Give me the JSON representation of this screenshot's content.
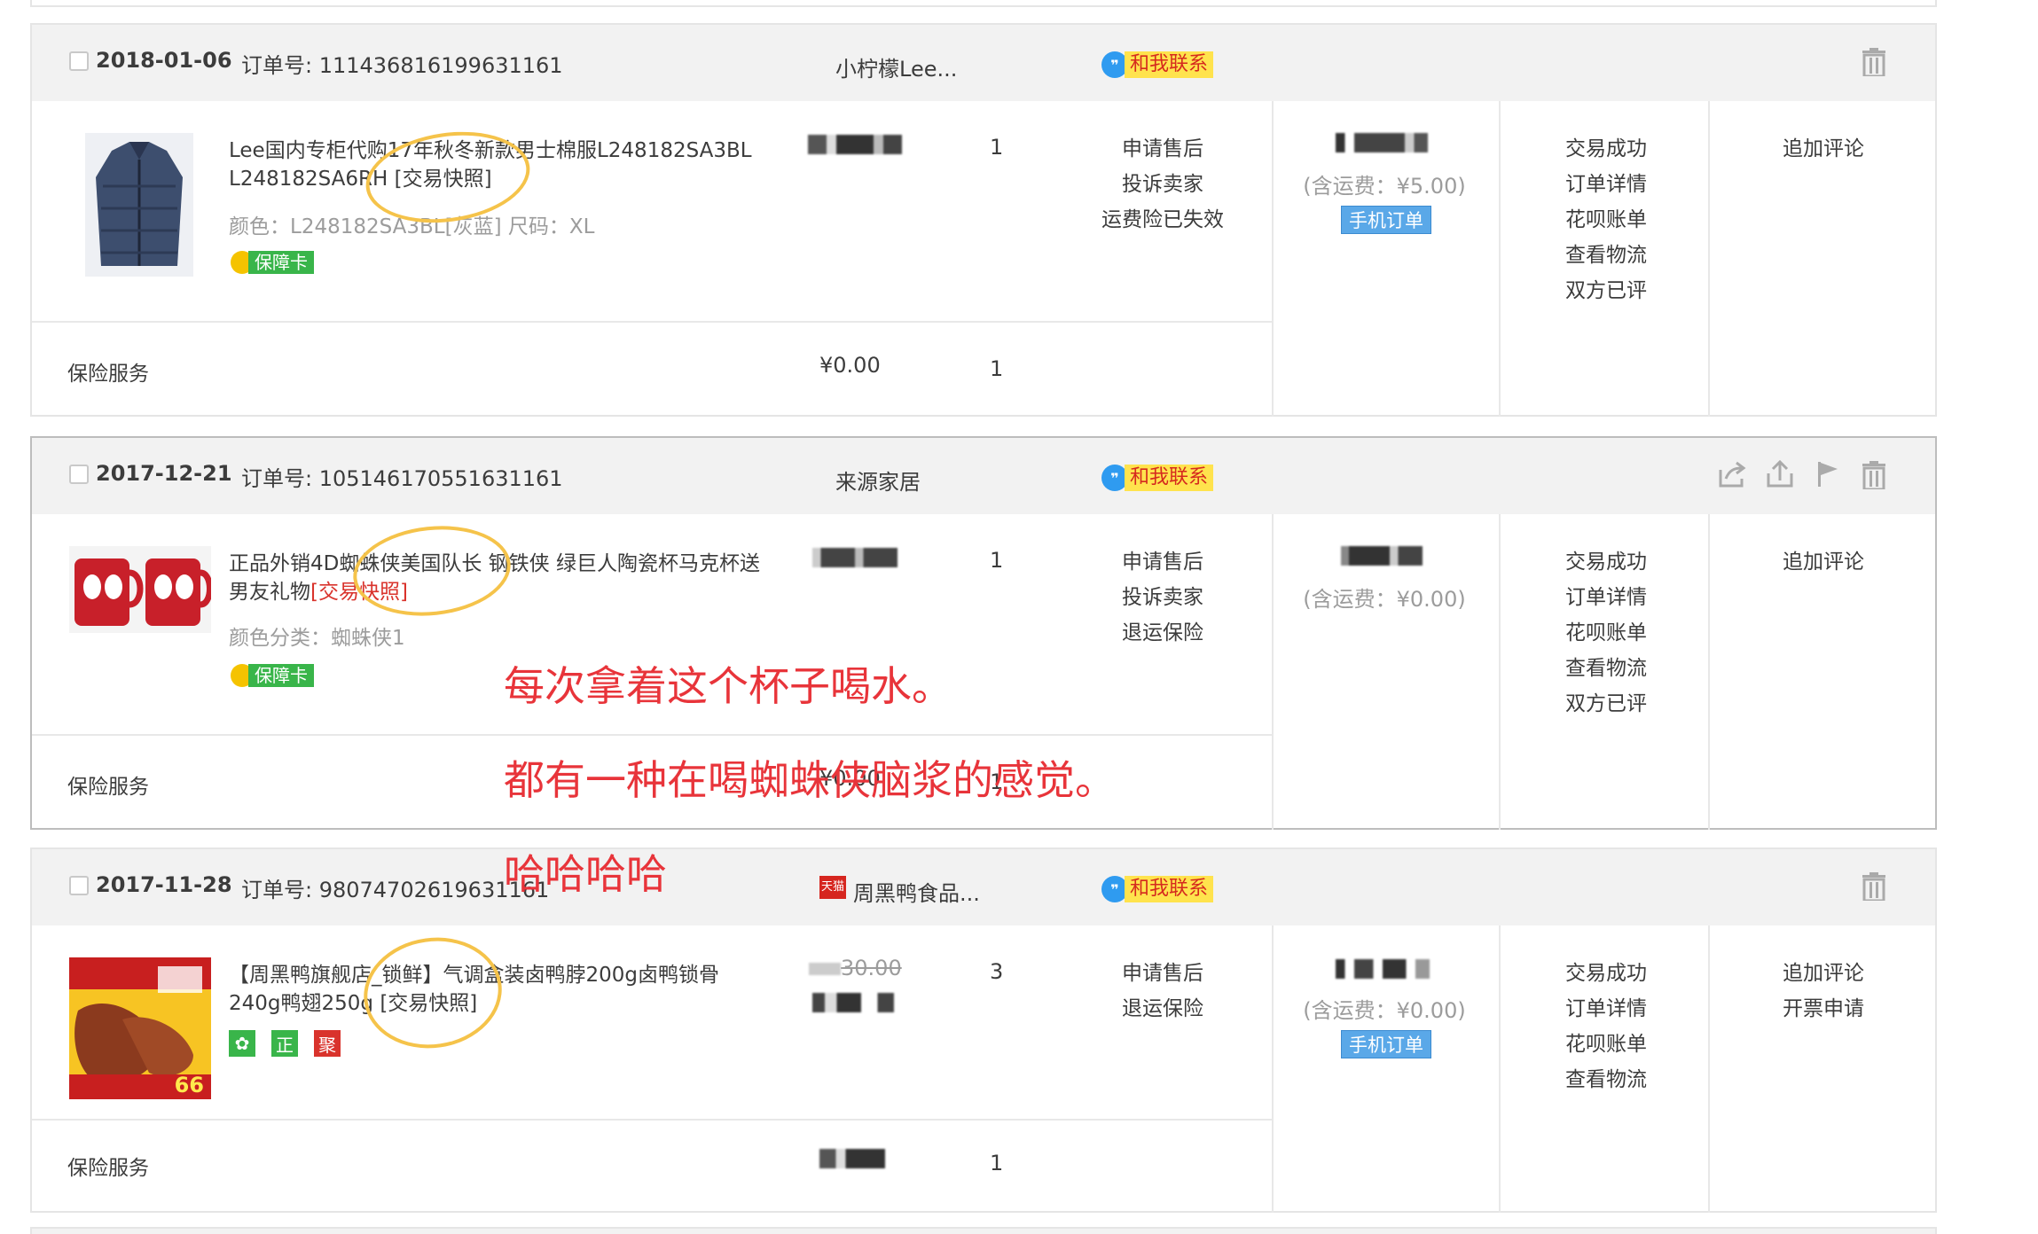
{
  "orders": [
    {
      "date": "2018-01-06",
      "order_no": "订单号: 111436816199631161",
      "shop": "小柠檬Lee...",
      "contact": "和我联系",
      "item_title": "Lee国内专柜代购17年秋冬新款男士棉服L248182SA3BL L248182SA6RH",
      "snapshot": "[交易快照]",
      "item_spec": "颜色：L248182SA3BL[灰蓝] 尺码：XL",
      "guarantee": "保障卡",
      "qty": "1",
      "after_sale": [
        "申请售后",
        "投诉卖家",
        "运费险已失效"
      ],
      "shipping": "(含运费：¥5.00)",
      "mobile_tag": "手机订单",
      "status_links": [
        "交易成功",
        "订单详情",
        "花呗账单",
        "查看物流",
        "双方已评"
      ],
      "action_links": [
        "追加评论"
      ],
      "insurance_label": "保险服务",
      "insurance_price": "¥0.00",
      "insurance_qty": "1"
    },
    {
      "date": "2017-12-21",
      "order_no": "订单号: 105146170551631161",
      "shop": "来源家居",
      "contact": "和我联系",
      "item_title": "正品外销4D蜘蛛侠美国队长 钢铁侠 绿巨人陶瓷杯马克杯送男友礼物",
      "snapshot": "[交易快照]",
      "item_spec": "颜色分类：蜘蛛侠1",
      "guarantee": "保障卡",
      "qty": "1",
      "after_sale": [
        "申请售后",
        "投诉卖家",
        "退运保险"
      ],
      "shipping": "(含运费：¥0.00)",
      "status_links": [
        "交易成功",
        "订单详情",
        "花呗账单",
        "查看物流",
        "双方已评"
      ],
      "action_links": [
        "追加评论"
      ],
      "insurance_label": "保险服务",
      "insurance_price": "¥0.00",
      "insurance_qty": "1"
    },
    {
      "date": "2017-11-28",
      "order_no": "订单号: 98074702619631161",
      "shop_badge": "天猫",
      "shop": "周黑鸭食品...",
      "contact": "和我联系",
      "item_title": "【周黑鸭旗舰店_锁鲜】气调盒装卤鸭脖200g卤鸭锁骨240g鸭翅250g",
      "snapshot": "[交易快照]",
      "service_icons": [
        "正",
        "聚"
      ],
      "price_original": "30.00",
      "qty": "3",
      "after_sale": [
        "申请售后",
        "退运保险"
      ],
      "shipping": "(含运费：¥0.00)",
      "mobile_tag": "手机订单",
      "status_links": [
        "交易成功",
        "订单详情",
        "花呗账单",
        "查看物流"
      ],
      "action_links": [
        "追加评论",
        "开票申请"
      ],
      "insurance_label": "保险服务",
      "insurance_qty": "1",
      "thumb_price": "66"
    }
  ],
  "annotations": [
    "每次拿着这个杯子喝水。",
    "都有一种在喝蜘蛛侠脑浆的感觉。",
    "哈哈哈哈"
  ],
  "colors": {
    "header_bg": "#f2f2f2",
    "contact_yellow": "#ffe34d",
    "annotation_red": "#e8343a",
    "mobile_blue": "#5aa8e8"
  }
}
